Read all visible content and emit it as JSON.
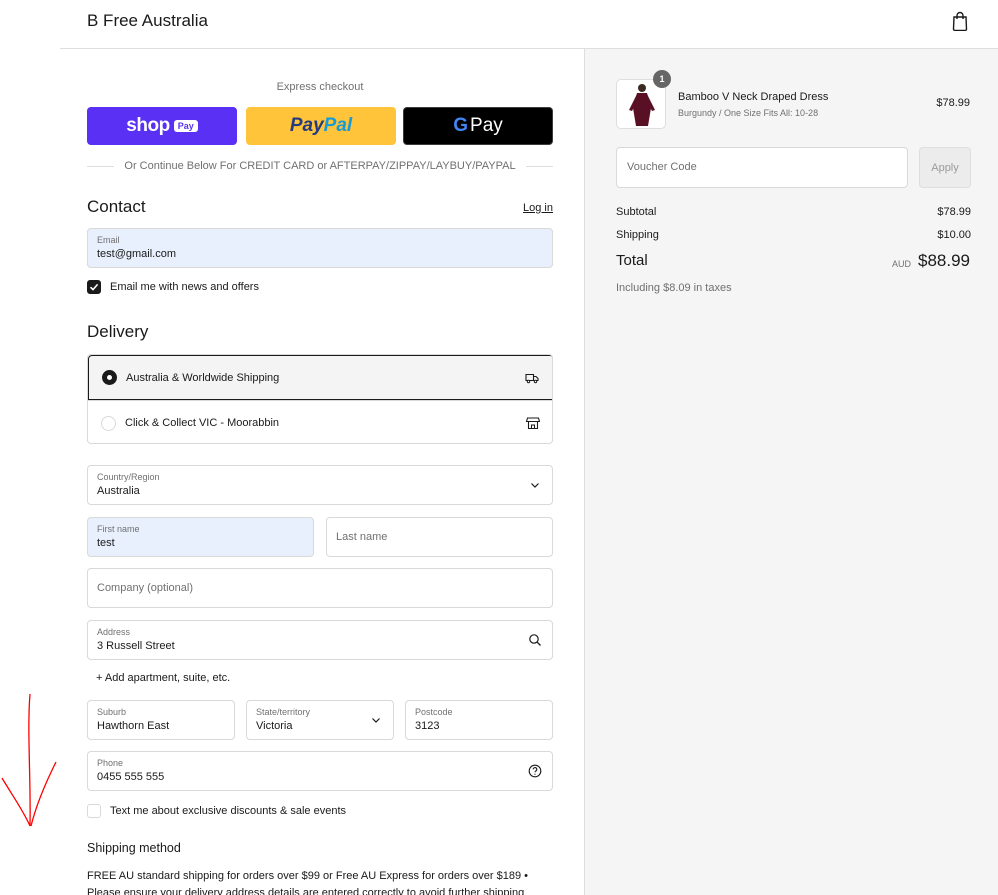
{
  "header": {
    "store_name": "B Free Australia",
    "cart_icon": "shopping-bag-icon"
  },
  "express": {
    "title": "Express checkout",
    "shop_pay": {
      "word": "shop",
      "badge": "Pay",
      "color": "#5a31f4"
    },
    "paypal": {
      "part1": "Pay",
      "part2": "Pal",
      "color": "#ffc439"
    },
    "gpay": {
      "g": "G",
      "label": "Pay",
      "color": "#000000"
    },
    "divider_text": "Or Continue Below For CREDIT CARD or AFTERPAY/ZIPPAY/LAYBUY/PAYPAL"
  },
  "contact": {
    "title": "Contact",
    "login_link": "Log in",
    "email_label": "Email",
    "email_value": "test@gmail.com",
    "news_checkbox_label": "Email me with news and offers",
    "news_checked": true
  },
  "delivery": {
    "title": "Delivery",
    "options": [
      {
        "label": "Australia & Worldwide Shipping",
        "selected": true,
        "icon": "truck-icon"
      },
      {
        "label": "Click & Collect VIC - Moorabbin",
        "selected": false,
        "icon": "store-icon"
      }
    ],
    "country_label": "Country/Region",
    "country_value": "Australia",
    "first_name_label": "First name",
    "first_name_value": "test",
    "last_name_placeholder": "Last name",
    "company_placeholder": "Company (optional)",
    "address_label": "Address",
    "address_value": "3 Russell Street",
    "add_apartment": "+ Add apartment, suite, etc.",
    "suburb_label": "Suburb",
    "suburb_value": "Hawthorn East",
    "state_label": "State/territory",
    "state_value": "Victoria",
    "postcode_label": "Postcode",
    "postcode_value": "3123",
    "phone_label": "Phone",
    "phone_value": "0455 555 555",
    "sms_checkbox_label": "Text me about exclusive discounts & sale events",
    "sms_checked": false
  },
  "shipping_method": {
    "title": "Shipping method",
    "text": "FREE AU standard shipping for orders over $99 or Free AU Express for orders over $189 • Please ensure your delivery address details are entered correctly to avoid further shipping"
  },
  "summary": {
    "product": {
      "quantity": "1",
      "name": "Bamboo V Neck Draped Dress",
      "variant": "Burgundy / One Size Fits All: 10-28",
      "price": "$78.99"
    },
    "voucher_placeholder": "Voucher Code",
    "apply_label": "Apply",
    "subtotal_label": "Subtotal",
    "subtotal_value": "$78.99",
    "shipping_label": "Shipping",
    "shipping_value": "$10.00",
    "total_label": "Total",
    "currency": "AUD",
    "total_value": "$88.99",
    "tax_note": "Including $8.09 in taxes"
  },
  "colors": {
    "annotation_arrow": "#ff0000",
    "field_autofill": "#e8f0fe",
    "sidebar_bg": "#f5f5f5"
  }
}
